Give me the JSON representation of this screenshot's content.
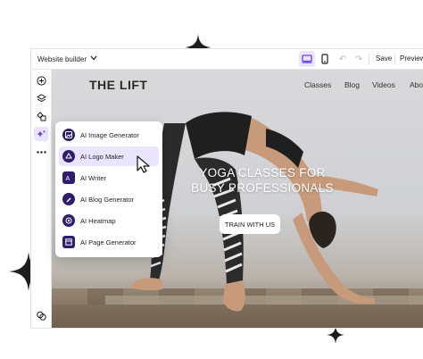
{
  "topbar": {
    "builder_label": "Website builder",
    "save_label": "Save",
    "preview_label": "Preview"
  },
  "site": {
    "logo": "THE LIFT",
    "nav": [
      "Classes",
      "Blog",
      "Videos",
      "Abo"
    ],
    "hero_title_line1": "YOGA CLASSES FOR",
    "hero_title_line2": "BUSY PROFESSIONALS",
    "cta_label": "TRAIN WITH US"
  },
  "ai_menu": {
    "items": [
      {
        "label": "AI Image Generator",
        "icon": "image-icon"
      },
      {
        "label": "AI Logo Maker",
        "icon": "logo-icon"
      },
      {
        "label": "AI Writer",
        "icon": "writer-icon"
      },
      {
        "label": "AI Blog Generator",
        "icon": "blog-icon"
      },
      {
        "label": "AI Heatmap",
        "icon": "heatmap-icon"
      },
      {
        "label": "AI Page Generator",
        "icon": "page-icon"
      }
    ],
    "active_index": 1
  },
  "colors": {
    "accent": "#673de6",
    "accent_light": "#ebe4ff",
    "icon_bg": "#2f1c6a"
  }
}
